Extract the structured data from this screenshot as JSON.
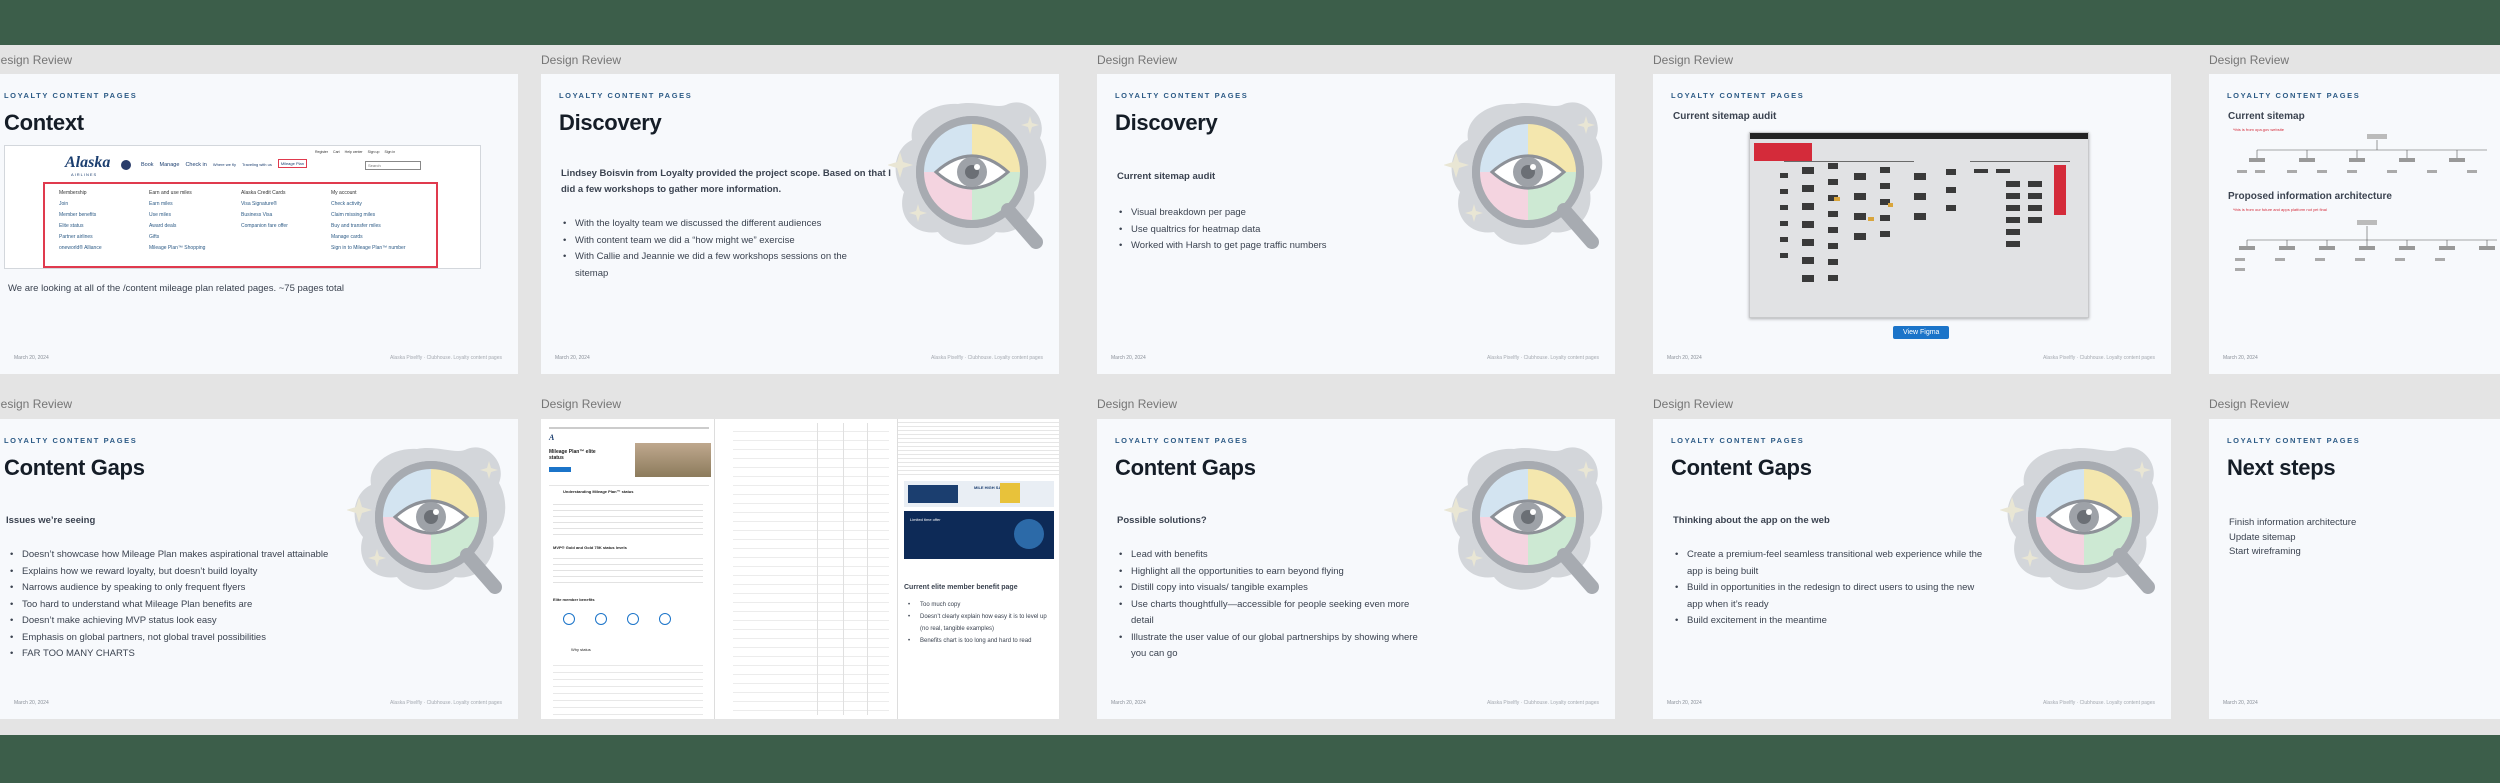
{
  "frames": [
    {
      "label": "Design Review",
      "eyebrow": "LOYALTY CONTENT PAGES",
      "title": "Context",
      "caption": "We are looking at all of the /content mileage plan related pages. ~75 pages total",
      "date": "March 20, 2024",
      "screenshot": {
        "logo": "Alaska",
        "logo_sub": "AIRLINES",
        "nav": [
          "Book",
          "Manage",
          "Check in",
          "Where we fly",
          "Traveling with us",
          "Mileage Plan"
        ],
        "utility": [
          "Register",
          "Cart",
          "Help center",
          "Sign up",
          "Sign in"
        ],
        "search_placeholder": "Search",
        "columns": [
          {
            "heading": "Membership",
            "links": [
              "Join",
              "Member benefits",
              "Elite status",
              "Partner airlines",
              "oneworld® Alliance"
            ]
          },
          {
            "heading": "Earn and use miles",
            "links": [
              "Earn miles",
              "Use miles",
              "Award deals",
              "Gifts",
              "Mileage Plan™ Shopping"
            ]
          },
          {
            "heading": "Alaska Credit Cards",
            "links": [
              "Visa Signature®",
              "Business Visa",
              "Companion fare offer"
            ]
          },
          {
            "heading": "My account",
            "links": [
              "Check activity",
              "Claim missing miles",
              "Buy and transfer miles",
              "Manage cards",
              "Sign in to Mileage Plan™ number"
            ]
          }
        ]
      }
    },
    {
      "label": "Design Review",
      "eyebrow": "LOYALTY CONTENT PAGES",
      "title": "Discovery",
      "para": "Lindsey Boisvin from Loyalty provided the project scope. Based on that I did a few workshops to gather more information.",
      "bullets": [
        "With the loyalty team we discussed the different audiences",
        "With content team we did a “how might we” exercise",
        "With Callie and Jeannie we did a few workshops sessions on the sitemap"
      ],
      "date": "March 20, 2024"
    },
    {
      "label": "Design Review",
      "eyebrow": "LOYALTY CONTENT PAGES",
      "title": "Discovery",
      "subhead": "Current sitemap audit",
      "bullets": [
        "Visual breakdown per page",
        "Use qualtrics for heatmap data",
        "Worked with Harsh to get page traffic numbers"
      ],
      "date": "March 20, 2024"
    },
    {
      "label": "Design Review",
      "eyebrow": "LOYALTY CONTENT PAGES",
      "subhead": "Current sitemap audit",
      "button": "View Figma",
      "date": "March 20, 2024"
    },
    {
      "label": "Design Review",
      "eyebrow": "LOYALTY CONTENT PAGES",
      "subhead_a": "Current sitemap",
      "subhead_b": "Proposed information architecture",
      "note_a": "*this is from opa.gov website",
      "note_b": "*this is from our future and apps platform not yet final",
      "date": "March 20, 2024"
    },
    {
      "label": "Design Review",
      "eyebrow": "LOYALTY CONTENT PAGES",
      "title": "Content Gaps",
      "subhead": "Issues we’re seeing",
      "bullets": [
        "Doesn’t showcase how Mileage Plan makes aspirational travel attainable",
        "Explains how we reward loyalty, but doesn’t build loyalty",
        "Narrows audience by speaking to only frequent flyers",
        "Too hard to understand what Mileage Plan benefits are",
        "Doesn’t make achieving MVP status look easy",
        "Emphasis on global partners, not global travel possibilities",
        "FAR TOO MANY CHARTS"
      ],
      "date": "March 20, 2024"
    },
    {
      "label": "Design Review",
      "page_a": {
        "heading": "Mileage Plan™ elite status",
        "section": "Understanding Mileage Plan™ status",
        "mvp": "MVP® Gold and Gold 75K status levels",
        "benefits": "Elite member benefits",
        "why": "Why status"
      },
      "page_c": {
        "heading": "Current elite member benefit page",
        "bullets": [
          "Too much copy",
          "Doesn’t clearly explain how easy it is to level up (no real, tangible examples)",
          "Benefits chart is too long and hard to read"
        ],
        "banner": "MILE HIGH SAVINGS",
        "promo": "Limited time offer"
      }
    },
    {
      "label": "Design Review",
      "eyebrow": "LOYALTY CONTENT PAGES",
      "title": "Content Gaps",
      "subhead": "Possible solutions?",
      "bullets": [
        "Lead with benefits",
        "Highlight all the opportunities to earn beyond flying",
        "Distill copy into visuals/ tangible examples",
        "Use charts thoughtfully—accessible for people seeking even more detail",
        "Illustrate the user value of our global partnerships by showing where you can go"
      ],
      "date": "March 20, 2024"
    },
    {
      "label": "Design Review",
      "eyebrow": "LOYALTY CONTENT PAGES",
      "title": "Content Gaps",
      "subhead": "Thinking about the app on the web",
      "bullets": [
        "Create a premium-feel seamless transitional web experience while the app is being built",
        "Build in opportunities in the redesign to direct users to using the new app when it’s ready",
        "Build excitement in the meantime"
      ],
      "date": "March 20, 2024"
    },
    {
      "label": "Design Review",
      "eyebrow": "LOYALTY CONTENT PAGES",
      "title": "Next steps",
      "items": [
        "Finish information architecture",
        "Update sitemap",
        "Start wireframing"
      ],
      "date": "March 20, 2024"
    }
  ],
  "footer_right": "Alaska Pixelfly · Clubhouse. Loyalty content pages",
  "colors": {
    "canvas_bg": "#3c5e4a",
    "board_bg": "#e4e4e4",
    "slide_bg": "#f7f9fc",
    "eyebrow": "#2d5b86",
    "highlight": "#e03a4e",
    "button": "#1b74c9"
  }
}
